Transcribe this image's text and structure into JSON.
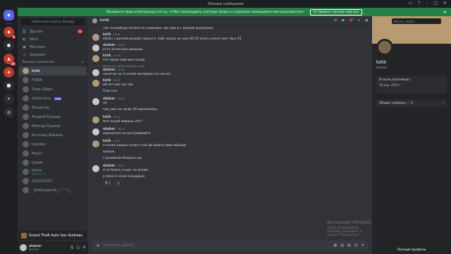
{
  "window": {
    "title": "Личные сообщения"
  },
  "banner": {
    "text": "Проверьте свою электронную почту, чтобы подтвердить учетную запись и сохранить имеющееся имя пользователя.",
    "button": "Отправить письмо ещё раз"
  },
  "sidebar": {
    "search": "Найти или начать беседу",
    "nav": [
      {
        "label": "Друзья",
        "icon": "friends-icon",
        "count": "1"
      },
      {
        "label": "Nitro",
        "icon": "nitro-icon"
      },
      {
        "label": "Магазин",
        "icon": "shop-icon"
      },
      {
        "label": "Задания",
        "icon": "quests-icon"
      }
    ],
    "dm_header": "Личные сообщения",
    "dms": [
      {
        "name": "kotik",
        "active": true
      },
      {
        "name": "FOMA"
      },
      {
        "name": "Тома Шарм"
      },
      {
        "name": "chista krov",
        "tag": "FAME"
      },
      {
        "name": "Владосик"
      },
      {
        "name": "Андрей Кудиер"
      },
      {
        "name": "Моисар Кудиер"
      },
      {
        "name": "Антонио Вивальi"
      },
      {
        "name": "Danikov"
      },
      {
        "name": "Myers"
      },
      {
        "name": "Санёк"
      },
      {
        "name": "Denis",
        "sub": "NEXTSP +1"
      },
      {
        "name": "222222222"
      },
      {
        "name": "_SerbiLegend\\_/-^-^\\_"
      }
    ],
    "activity": "Grand Theft Auto San Andreas",
    "user": {
      "name": "abakan",
      "status": "NEXTSP"
    }
  },
  "chat": {
    "header": "kotik",
    "messages": [
      {
        "type": "cont",
        "text": "так ты вообще нечего не снижешь так еще и с резкой жыграешь"
      },
      {
        "type": "msg",
        "author": "kotik",
        "time": "16:16",
        "lines": [
          "еблан с резкой резкой спросе у тейп мапрс он мне 40:15 упал у меня пинг был 25"
        ]
      },
      {
        "type": "msg",
        "author": "abakan",
        "time": "16:16",
        "lines": [
          "кста зачем ион решишь"
        ]
      },
      {
        "type": "msg",
        "author": "kotik",
        "time": "16:16",
        "lines": [
          "это твоик мой мне похуй"
        ]
      },
      {
        "type": "reply",
        "text": "@kotik это твоик мой мне похуй"
      },
      {
        "type": "msg",
        "author": "abakan",
        "time": "16:16",
        "lines": [
          "понятно ну я коплю материал по нон рп"
        ]
      },
      {
        "type": "msg",
        "author": "kotik",
        "time": "16:17",
        "lines": [
          "ой нет как же так",
          "1час кпз"
        ]
      },
      {
        "type": "msg",
        "author": "abakan",
        "time": "16:18",
        "lines": [
          "не",
          "так уже на часво 20 накопилась"
        ]
      },
      {
        "type": "msg",
        "author": "kotik",
        "time": "16:19",
        "lines": [
          "мне похуй веришь нет?"
        ]
      },
      {
        "type": "msg",
        "author": "abakan",
        "time": "16:19",
        "lines": [
          "хорачи все не растраивайся"
        ]
      },
      {
        "type": "msg",
        "author": "kotik",
        "time": "16:22",
        "lines": [
          "я понял кишка тонка чтоб дм выйти свин ебаный",
          "ахахха",
          "с рыжиком боишься да"
        ]
      },
      {
        "type": "msg",
        "author": "abakan",
        "time": "16:23",
        "lines": [
          "я не боюсь я щас не играю",
          "у меня 3 ночи полудурок"
        ]
      }
    ],
    "reaction": {
      "emoji": "😇",
      "count": "1"
    },
    "composer_placeholder": "Написать @kotik"
  },
  "profile": {
    "search": "Искать «kotik»",
    "name": "kotik",
    "username": "resuns",
    "member_since_label": "В числе участников с",
    "member_since": "16 мар. 2024 г.",
    "mutual_servers": "Общие серверы — 2",
    "full_profile": "Полный профиль"
  },
  "watermark": {
    "title": "Активация Windows",
    "subtitle": "Чтобы активировать Windows, перейдите в раздел \"Параметры\"."
  }
}
